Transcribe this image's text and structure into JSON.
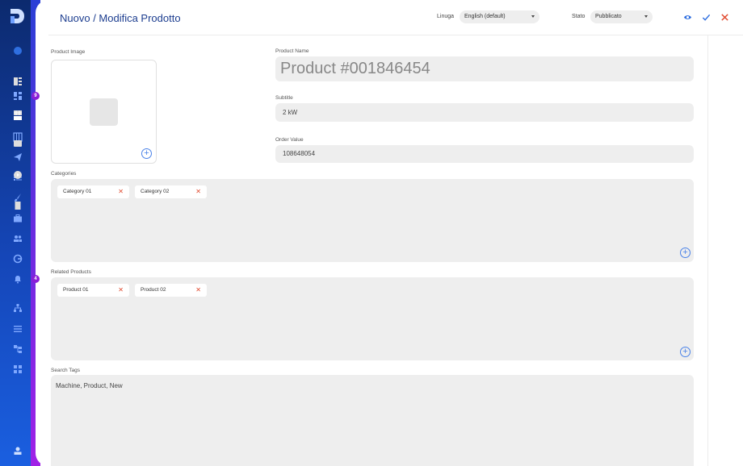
{
  "header": {
    "title": "Nuovo / Modifica Prodotto",
    "language_label": "Linuga",
    "language_value": "English (default)",
    "status_label": "Stato",
    "status_value": "Pubblicato"
  },
  "sidebar": {
    "badges": [
      "9",
      "4"
    ]
  },
  "form": {
    "image_label": "Product Image",
    "name_label": "Product Name",
    "name_value": "Product #001846454",
    "subtitle_label": "Subtitle",
    "subtitle_value": "2 kW",
    "order_label": "Order Value",
    "order_value": "108648054",
    "categories_label": "Categories",
    "categories": [
      "Category 01",
      "Category 02"
    ],
    "related_label": "Related Products",
    "related": [
      "Product 01",
      "Product 02"
    ],
    "tags_label": "Search Tags",
    "tags_value": "Machine, Product, New"
  },
  "colors": {
    "accent": "#1c3d8f",
    "link": "#4a82e8",
    "danger": "#e0482c"
  }
}
